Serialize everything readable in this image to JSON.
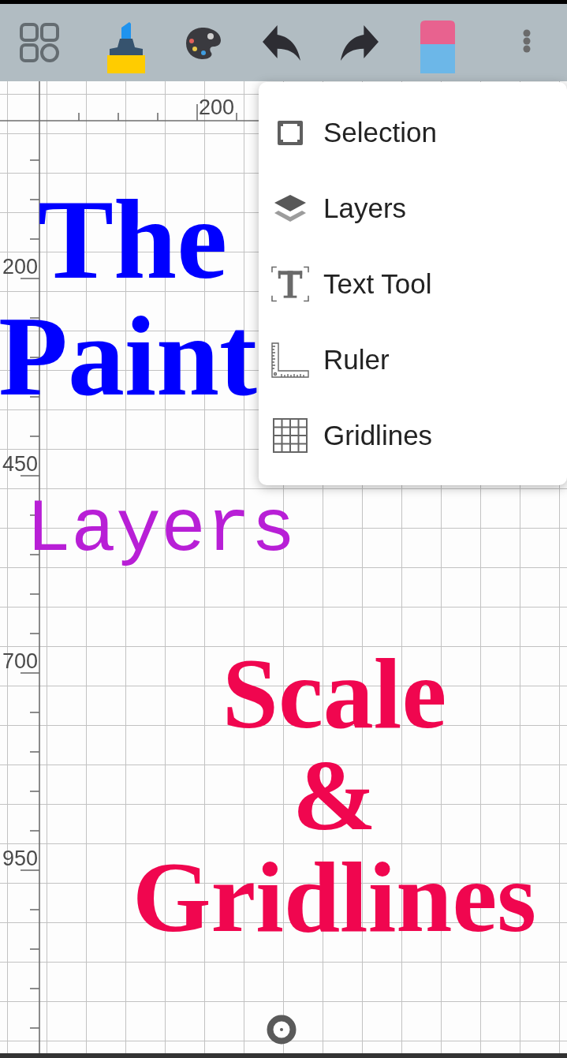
{
  "top_ruler": {
    "labels": [
      "200"
    ]
  },
  "left_ruler": {
    "labels": [
      "200",
      "450",
      "700",
      "950"
    ]
  },
  "canvas": {
    "text_objects": [
      {
        "kind": "serif",
        "color": "#0000ff",
        "lines": [
          "The",
          "Paint"
        ]
      },
      {
        "kind": "mono",
        "color": "#b81fd6",
        "lines": [
          "Layers"
        ]
      },
      {
        "kind": "serif",
        "color": "#f0064f",
        "lines": [
          "Scale",
          "&",
          "Gridlines"
        ]
      }
    ]
  },
  "menu": {
    "items": [
      {
        "label": "Selection"
      },
      {
        "label": "Layers"
      },
      {
        "label": "Text Tool"
      },
      {
        "label": "Ruler"
      },
      {
        "label": "Gridlines"
      }
    ]
  }
}
